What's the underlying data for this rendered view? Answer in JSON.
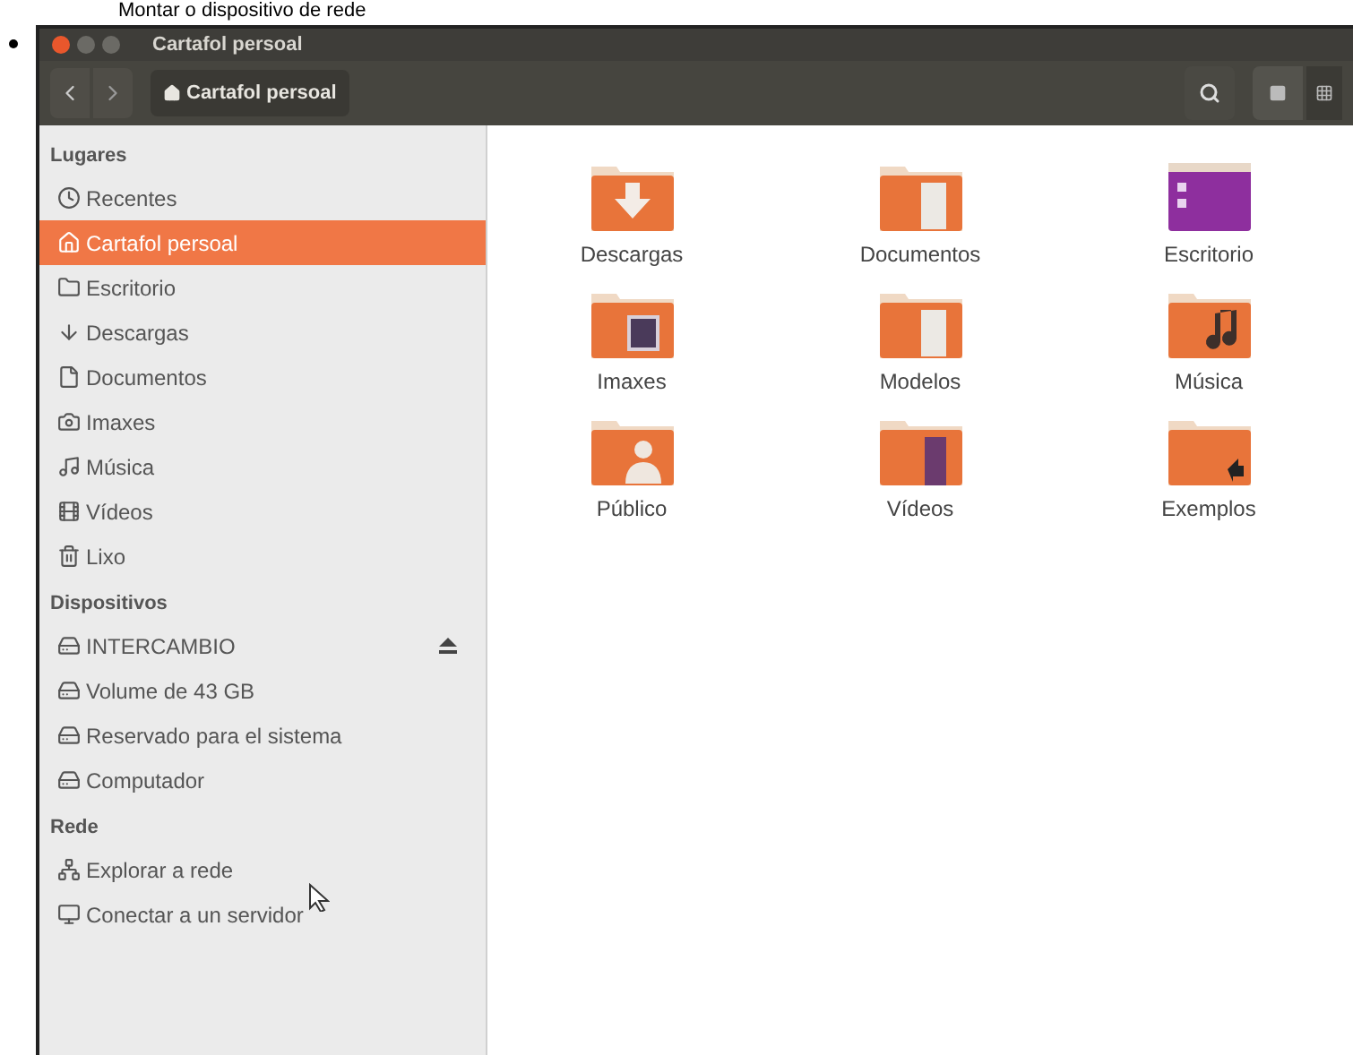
{
  "page_heading": "Montar o dispositivo de rede",
  "window": {
    "title": "Cartafol persoal"
  },
  "toolbar": {
    "path_button": "Cartafol persoal"
  },
  "sidebar": {
    "sections": [
      {
        "title": "Lugares",
        "items": [
          {
            "label": "Recentes",
            "selected": false,
            "ejectable": false
          },
          {
            "label": "Cartafol persoal",
            "selected": true,
            "ejectable": false
          },
          {
            "label": "Escritorio",
            "selected": false,
            "ejectable": false
          },
          {
            "label": "Descargas",
            "selected": false,
            "ejectable": false
          },
          {
            "label": "Documentos",
            "selected": false,
            "ejectable": false
          },
          {
            "label": "Imaxes",
            "selected": false,
            "ejectable": false
          },
          {
            "label": "Música",
            "selected": false,
            "ejectable": false
          },
          {
            "label": "Vídeos",
            "selected": false,
            "ejectable": false
          },
          {
            "label": "Lixo",
            "selected": false,
            "ejectable": false
          }
        ]
      },
      {
        "title": "Dispositivos",
        "items": [
          {
            "label": "INTERCAMBIO",
            "selected": false,
            "ejectable": true
          },
          {
            "label": "Volume de 43 GB",
            "selected": false,
            "ejectable": false
          },
          {
            "label": "Reservado para el sistema",
            "selected": false,
            "ejectable": false
          },
          {
            "label": "Computador",
            "selected": false,
            "ejectable": false
          }
        ]
      },
      {
        "title": "Rede",
        "items": [
          {
            "label": "Explorar a rede",
            "selected": false,
            "ejectable": false
          },
          {
            "label": "Conectar a un servidor",
            "selected": false,
            "ejectable": false
          }
        ]
      }
    ]
  },
  "files": [
    {
      "name": "Descargas"
    },
    {
      "name": "Documentos"
    },
    {
      "name": "Escritorio"
    },
    {
      "name": "Imaxes"
    },
    {
      "name": "Modelos"
    },
    {
      "name": "Música"
    },
    {
      "name": "Público"
    },
    {
      "name": "Vídeos"
    },
    {
      "name": "Exemplos"
    }
  ]
}
